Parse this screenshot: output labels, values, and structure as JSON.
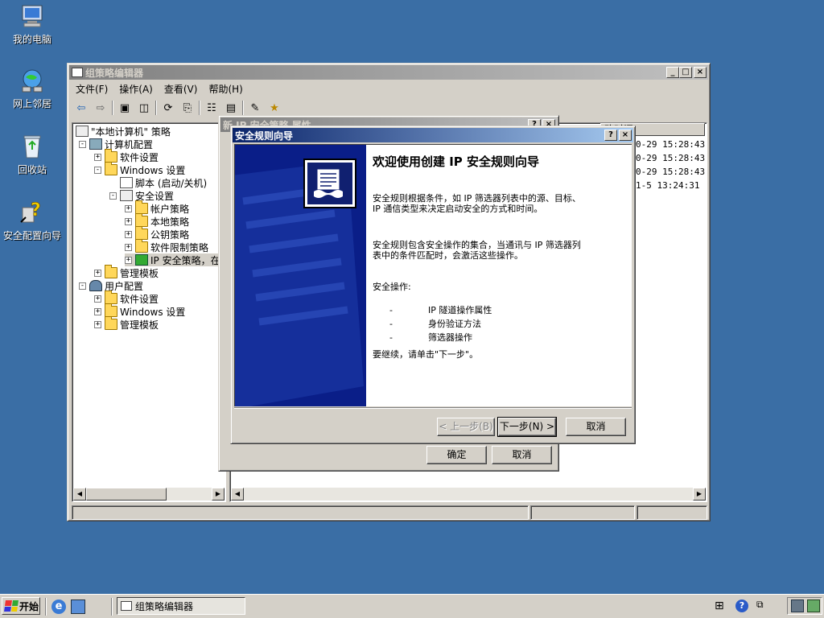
{
  "desktop": {
    "icons": [
      {
        "label": "我的电脑",
        "icon": "my-computer-icon"
      },
      {
        "label": "网上邻居",
        "icon": "network-places-icon"
      },
      {
        "label": "回收站",
        "icon": "recycle-bin-icon"
      },
      {
        "label": "安全配置向导",
        "icon": "security-wizard-icon"
      }
    ]
  },
  "gpedit": {
    "title": "组策略编辑器",
    "menu": [
      "文件(F)",
      "操作(A)",
      "查看(V)",
      "帮助(H)"
    ],
    "toolbar": [
      "back-icon",
      "forward-icon",
      "up-folder-icon",
      "show-hide-tree-icon",
      "refresh-icon",
      "export-list-icon",
      "properties-icon",
      "help-icon",
      "create-policy-icon",
      "manage-filters-icon"
    ],
    "tree": [
      {
        "label": "\"本地计算机\" 策略",
        "level": 0,
        "expander": "",
        "icon": "policy-icon"
      },
      {
        "label": "计算机配置",
        "level": 1,
        "expander": "-",
        "icon": "computer-config-icon"
      },
      {
        "label": "软件设置",
        "level": 2,
        "expander": "+",
        "icon": "folder-icon"
      },
      {
        "label": "Windows 设置",
        "level": 2,
        "expander": "-",
        "icon": "folder-icon"
      },
      {
        "label": "脚本 (启动/关机)",
        "level": 3,
        "expander": "",
        "icon": "script-icon"
      },
      {
        "label": "安全设置",
        "level": 3,
        "expander": "-",
        "icon": "security-settings-icon"
      },
      {
        "label": "帐户策略",
        "level": 4,
        "expander": "+",
        "icon": "folder-icon"
      },
      {
        "label": "本地策略",
        "level": 4,
        "expander": "+",
        "icon": "folder-icon"
      },
      {
        "label": "公钥策略",
        "level": 4,
        "expander": "+",
        "icon": "folder-icon"
      },
      {
        "label": "软件限制策略",
        "level": 4,
        "expander": "+",
        "icon": "folder-icon"
      },
      {
        "label": "IP 安全策略，在",
        "level": 4,
        "expander": "+",
        "icon": "ip-security-icon"
      },
      {
        "label": "管理模板",
        "level": 2,
        "expander": "+",
        "icon": "folder-icon"
      },
      {
        "label": "用户配置",
        "level": 1,
        "expander": "-",
        "icon": "user-config-icon"
      },
      {
        "label": "软件设置",
        "level": 2,
        "expander": "+",
        "icon": "folder-icon"
      },
      {
        "label": "Windows 设置",
        "level": 2,
        "expander": "+",
        "icon": "folder-icon"
      },
      {
        "label": "管理模板",
        "level": 2,
        "expander": "+",
        "icon": "folder-icon"
      }
    ],
    "list_header": "改时间",
    "list_rows": [
      "0-29 15:28:43",
      "0-29 15:28:43",
      "0-29 15:28:43",
      "1-5 13:24:31"
    ]
  },
  "properties_dialog": {
    "title": "新 IP 安全策略 属性",
    "ok": "确定",
    "cancel": "取消"
  },
  "wizard": {
    "title": "安全规则向导",
    "heading": "欢迎使用创建 IP 安全规则向导",
    "para1": "安全规则根据条件，如 IP 筛选器列表中的源、目标、\nIP 通信类型来决定启动安全的方式和时间。",
    "para2": "安全规则包含安全操作的集合，当通讯与 IP 筛选器列\n表中的条件匹配时，会激活这些操作。",
    "ops_label": "安全操作:",
    "ops": [
      {
        "bullet": "-",
        "text": "IP 隧道操作属性"
      },
      {
        "bullet": "-",
        "text": "身份验证方法"
      },
      {
        "bullet": "-",
        "text": "筛选器操作"
      }
    ],
    "continue": "要继续，请单击\"下一步\"。",
    "back_btn": "< 上一步(B)",
    "next_btn": "下一步(N) >",
    "cancel_btn": "取消"
  },
  "taskbar": {
    "start": "开始",
    "task": "组策略编辑器"
  }
}
